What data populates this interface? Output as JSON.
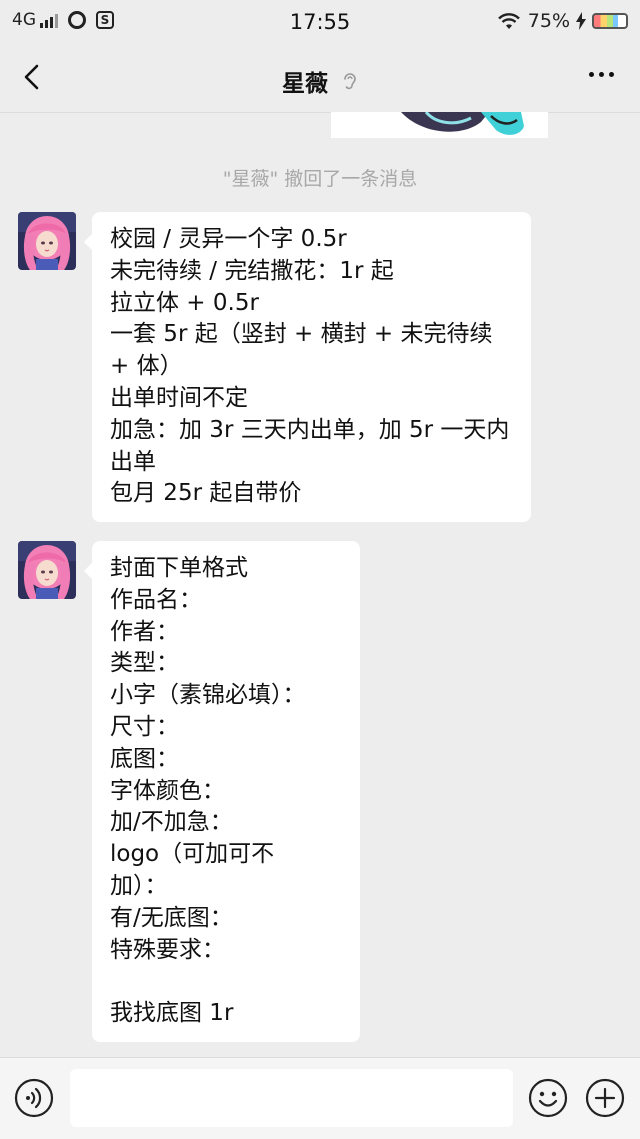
{
  "status_bar": {
    "network": "4G",
    "time": "17:55",
    "battery": "75%"
  },
  "header": {
    "title": "星薇",
    "back_icon": "chevron-left-icon",
    "ear_icon": "ear-icon",
    "more_icon": "more-dots-icon"
  },
  "chat": {
    "recall_notice": "\"星薇\" 撤回了一条消息",
    "messages": [
      {
        "sender": "星薇",
        "lines": [
          "校园 / 灵异一个字 0.5r",
          "未完待续 / 完结撒花：1r 起",
          "拉立体 + 0.5r",
          "一套 5r 起（竖封 + 横封 + 未完待续",
          "+ 体）",
          "出单时间不定",
          "加急：加 3r 三天内出单，加 5r 一天内",
          "出单",
          "包月 25r 起自带价"
        ]
      },
      {
        "sender": "星薇",
        "lines": [
          "封面下单格式",
          "作品名：",
          "作者：",
          "类型：",
          "小字（素锦必填）：",
          "尺寸：",
          "底图：",
          "字体颜色：",
          "加/不加急：",
          "logo（可加可不",
          "加）：",
          "有/无底图：",
          "特殊要求：",
          "",
          "我找底图 1r"
        ]
      }
    ]
  },
  "input_bar": {
    "value": "",
    "voice_icon": "voice-icon",
    "emoji_icon": "emoji-icon",
    "plus_icon": "plus-icon"
  },
  "colors": {
    "background": "#ededed",
    "bubble": "#ffffff",
    "notice_text": "#a8a8a8",
    "input_bar": "#f5f5f5"
  }
}
